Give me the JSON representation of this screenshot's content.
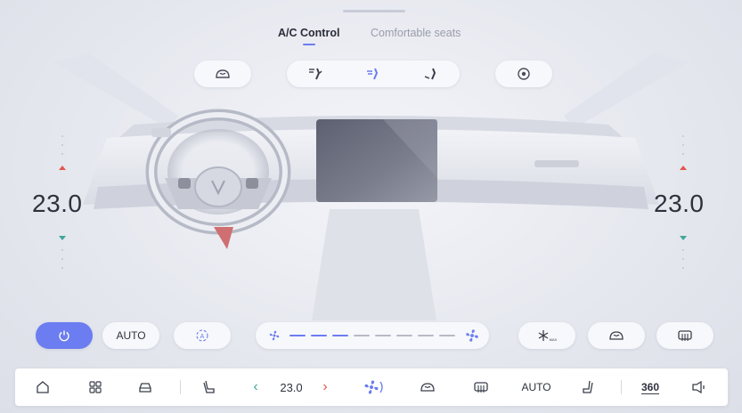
{
  "tabs": [
    {
      "label": "A/C Control",
      "active": true
    },
    {
      "label": "Comfortable seats",
      "active": false
    }
  ],
  "vent_modes": {
    "icons": [
      "windshield-defrost-icon",
      "vent-face-defrost-icon",
      "vent-face-icon",
      "vent-face-feet-icon",
      "vent-target-icon"
    ]
  },
  "left_temp": {
    "value": "23.0"
  },
  "right_temp": {
    "value": "23.0"
  },
  "controls": {
    "power_on": true,
    "auto_label": "AUTO",
    "fan_level": 0.4
  },
  "dock": {
    "temp_value": "23.0",
    "auto_label": "AUTO",
    "view_360_label": "360"
  },
  "colors": {
    "accent": "#6b7df0",
    "temp_up": "#e2574f",
    "temp_down": "#3fa79a",
    "chevron_left": "#3fa79a",
    "chevron_right": "#e2574f"
  }
}
